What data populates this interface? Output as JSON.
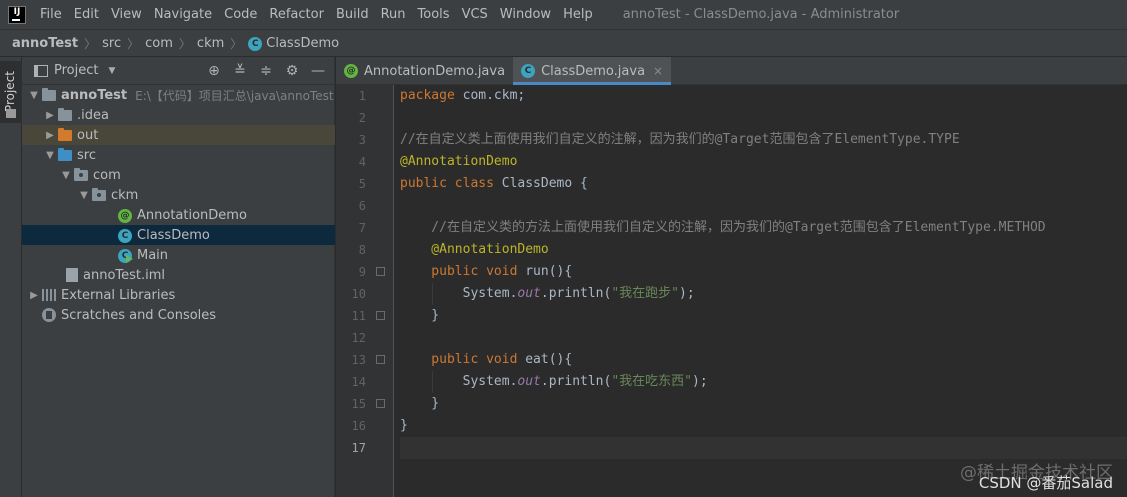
{
  "menubar": {
    "logo": "IJ",
    "items": [
      "File",
      "Edit",
      "View",
      "Navigate",
      "Code",
      "Refactor",
      "Build",
      "Run",
      "Tools",
      "VCS",
      "Window",
      "Help"
    ],
    "window_title": "annoTest - ClassDemo.java - Administrator"
  },
  "breadcrumb": [
    "annoTest",
    "src",
    "com",
    "ckm",
    "ClassDemo"
  ],
  "toolstrip": {
    "label": "Project"
  },
  "project_panel": {
    "title": "Project",
    "tree": [
      {
        "label": "annoTest",
        "path": "E:\\【代码】项目汇总\\java\\annoTest"
      },
      {
        "label": ".idea"
      },
      {
        "label": "out"
      },
      {
        "label": "src"
      },
      {
        "label": "com"
      },
      {
        "label": "ckm"
      },
      {
        "label": "AnnotationDemo"
      },
      {
        "label": "ClassDemo"
      },
      {
        "label": "Main"
      },
      {
        "label": "annoTest.iml"
      },
      {
        "label": "External Libraries"
      },
      {
        "label": "Scratches and Consoles"
      }
    ]
  },
  "tabs": [
    {
      "label": "AnnotationDemo.java"
    },
    {
      "label": "ClassDemo.java",
      "close": "×"
    }
  ],
  "editor": {
    "line_numbers": [
      "1",
      "2",
      "3",
      "4",
      "5",
      "6",
      "7",
      "8",
      "9",
      "10",
      "11",
      "12",
      "13",
      "14",
      "15",
      "16",
      "17"
    ],
    "code": {
      "l1_kw": "package",
      "l1_rest": " com.ckm;",
      "l3": "//在自定义类上面使用我们自定义的注解，因为我们的@Target范围包含了ElementType.TYPE",
      "l4": "@AnnotationDemo",
      "l5_kw": "public class",
      "l5_rest": " ClassDemo {",
      "l7": "    //在自定义类的方法上面使用我们自定义的注解，因为我们的@Target范围包含了ElementType.METHOD",
      "l8": "    @AnnotationDemo",
      "l9_kw": "    public void",
      "l9_name": " run",
      "l9_rest": "(){",
      "l10_a": "        System.",
      "l10_fn": "out",
      "l10_b": ".println(",
      "l10_str": "\"我在跑步\"",
      "l10_c": ");",
      "l11": "    }",
      "l13_kw": "    public void",
      "l13_name": " eat",
      "l13_rest": "(){",
      "l14_a": "        System.",
      "l14_fn": "out",
      "l14_b": ".println(",
      "l14_str": "\"我在吃东西\"",
      "l14_c": ");",
      "l15": "    }",
      "l16": "}"
    }
  },
  "watermark": {
    "line1": "@稀土掘金技术社区",
    "line2": "CSDN @番茄Salad"
  },
  "colors": {
    "keyword": "#cc7832",
    "comment": "#808080",
    "annotation": "#bbb529",
    "string": "#6a8759",
    "field": "#9876aa",
    "selection": "#0d293e",
    "tab_accent": "#4a88c7"
  }
}
